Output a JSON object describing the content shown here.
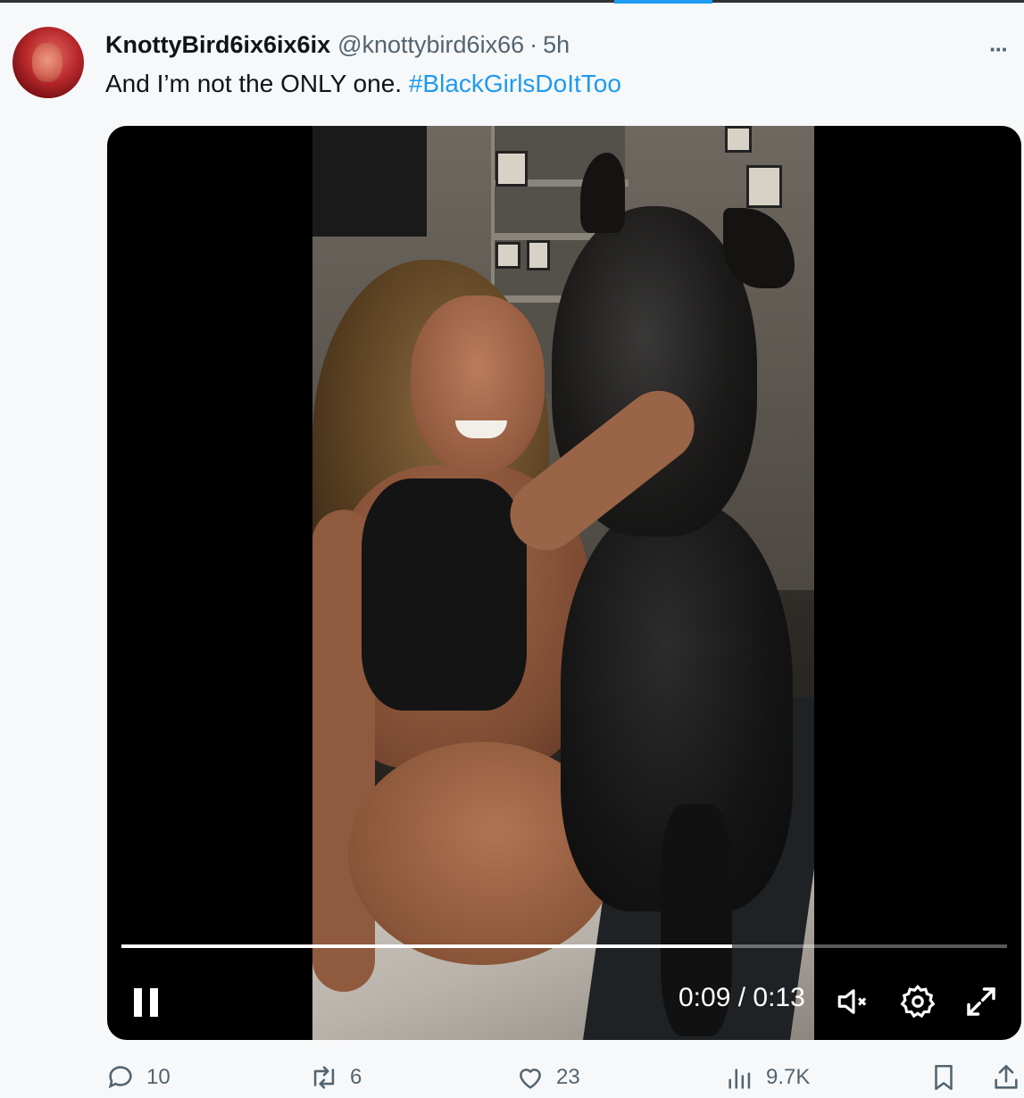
{
  "tweet": {
    "display_name": "KnottyBird6ix6ix6ix",
    "handle": "@knottybird6ix66",
    "separator": "·",
    "time_ago": "5h",
    "more_label": "···",
    "text_plain": "And I’m not the ONLY one.",
    "text_hashtag": "#BlackGirlsDoItToo"
  },
  "video": {
    "time_display": "0:09 / 0:13",
    "progress_fraction": 0.69,
    "state": "playing",
    "muted": true
  },
  "actions": {
    "replies": "10",
    "reposts": "6",
    "likes": "23",
    "views": "9.7K"
  },
  "icons": {
    "more": "more-horizontal-icon",
    "pause": "pause-icon",
    "mute": "volume-muted-icon",
    "settings": "gear-icon",
    "fullscreen": "expand-icon",
    "reply": "reply-bubble-icon",
    "repost": "repost-icon",
    "like": "heart-icon",
    "views": "bar-chart-icon",
    "bookmark": "bookmark-icon",
    "share": "share-icon"
  },
  "colors": {
    "link_blue": "#1d9bf0",
    "secondary_text": "#536471"
  }
}
